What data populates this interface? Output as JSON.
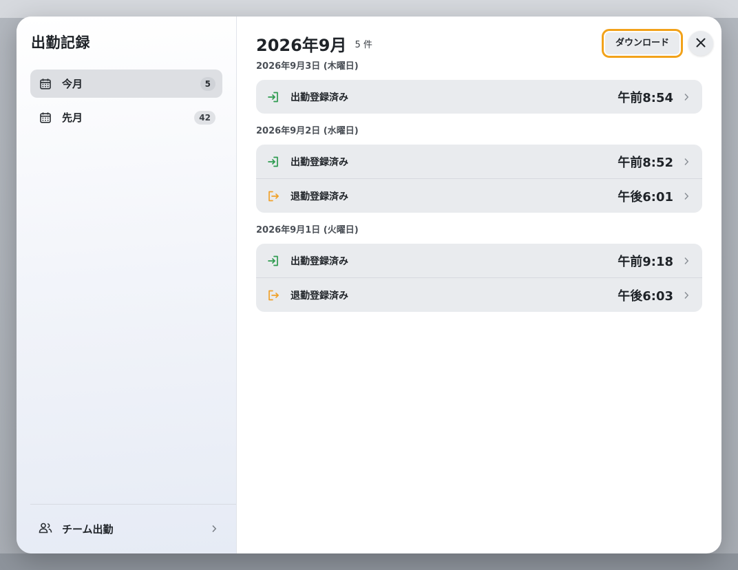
{
  "sidebar": {
    "title": "出勤記録",
    "items": [
      {
        "label": "今月",
        "count": "5"
      },
      {
        "label": "先月",
        "count": "42"
      }
    ],
    "footer_label": "チーム出勤"
  },
  "header": {
    "title": "2026年9月",
    "count": "5 件",
    "download_label": "ダウンロード"
  },
  "days": [
    {
      "label": "2026年9月3日 (木曜日)",
      "records": [
        {
          "type": "in",
          "label": "出勤登録済み",
          "time": "午前8:54"
        }
      ]
    },
    {
      "label": "2026年9月2日 (水曜日)",
      "records": [
        {
          "type": "in",
          "label": "出勤登録済み",
          "time": "午前8:52"
        },
        {
          "type": "out",
          "label": "退勤登録済み",
          "time": "午後6:01"
        }
      ]
    },
    {
      "label": "2026年9月1日 (火曜日)",
      "records": [
        {
          "type": "in",
          "label": "出勤登録済み",
          "time": "午前9:18"
        },
        {
          "type": "out",
          "label": "退勤登録済み",
          "time": "午後6:03"
        }
      ]
    }
  ],
  "colors": {
    "clock_in": "#2e9b4f",
    "clock_out": "#f0a12a",
    "accent_focus": "#f2a21a"
  },
  "icons": {
    "nav": "calendar-icon",
    "footer": "people-icon",
    "clock_in": "login-icon",
    "clock_out": "logout-icon",
    "close": "close-icon",
    "row_chevron": "chevron-right-icon"
  }
}
